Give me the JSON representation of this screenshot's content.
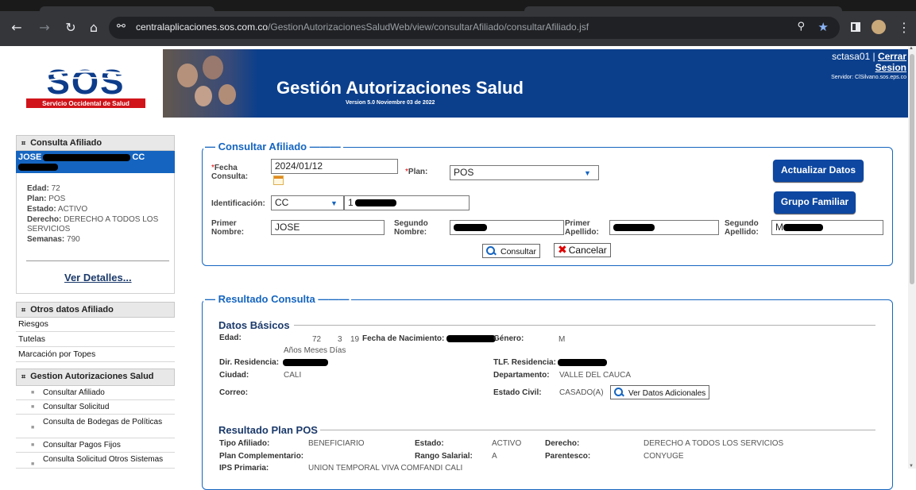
{
  "browser": {
    "url_domain": "centralaplicaciones.sos.com.co",
    "url_path": "/GestionAutorizacionesSaludWeb/view/consultarAfiliado/consultarAfiliado.jsf"
  },
  "header": {
    "logo_text": "SOS",
    "logo_subtitle": "Servicio Occidental de Salud",
    "title": "Gestión Autorizaciones Salud",
    "version": "Version 5.0 Noviembre 03 de 2022",
    "user": "sctasa01 |",
    "logout_line1": "Cerrar",
    "logout_line2": "Sesion",
    "server": "Servidor: ClSilvano.sos.eps.co"
  },
  "sidebar": {
    "consulta_afiliado": {
      "title": "Consulta Afiliado",
      "name": "JOSE",
      "doc_type": "CC",
      "edad_label": "Edad:",
      "edad": "72",
      "plan_label": "Plan:",
      "plan": "POS",
      "estado_label": "Estado:",
      "estado": "ACTIVO",
      "derecho_label": "Derecho:",
      "derecho": "DERECHO A TODOS LOS SERVICIOS",
      "semanas_label": "Semanas:",
      "semanas": "790",
      "ver_detalles": "Ver Detalles..."
    },
    "otros": {
      "title": "Otros datos Afiliado",
      "items": [
        "Riesgos",
        "Tutelas",
        "Marcación por Topes"
      ]
    },
    "gestion": {
      "title": "Gestion Autorizaciones Salud",
      "items": [
        "Consultar Afiliado",
        "Consultar Solicitud",
        "Consulta de Bodegas de Políticas",
        "Consultar Pagos Fijos",
        "Consulta Solicitud Otros Sistemas"
      ]
    }
  },
  "form": {
    "legend": "Consultar Afiliado",
    "fecha_label": "Fecha Consulta:",
    "fecha_value": "2024/01/12",
    "plan_label": "Plan:",
    "plan_value": "POS",
    "ident_label": "Identificación:",
    "ident_type": "CC",
    "ident_number_prefix": "1",
    "primer_nombre_label": "Primer Nombre:",
    "primer_nombre_value": "JOSE",
    "segundo_nombre_label": "Segundo Nombre:",
    "primer_apellido_label": "Primer Apellido:",
    "segundo_apellido_label": "Segundo Apellido:",
    "segundo_apellido_prefix": "M",
    "consultar": "Consultar",
    "cancelar": "Cancelar",
    "actualizar": "Actualizar Datos",
    "grupo": "Grupo Familiar"
  },
  "result": {
    "legend": "Resultado Consulta",
    "basicos_title": "Datos Básicos",
    "edad_label": "Edad:",
    "edad_y": "72",
    "edad_m": "3",
    "edad_d": "19",
    "edad_units": "Años Meses Días",
    "nacimiento_label": "Fecha de Nacimiento:",
    "genero_label": "Género:",
    "genero": "M",
    "dir_label": "Dir. Residencia:",
    "tlf_label": "TLF. Residencia:",
    "ciudad_label": "Ciudad:",
    "ciudad": "CALI",
    "depto_label": "Departamento:",
    "depto": "VALLE DEL CAUCA",
    "correo_label": "Correo:",
    "civil_label": "Estado Civil:",
    "civil": "CASADO(A)",
    "ver_adicionales": "Ver Datos Adicionales",
    "plan_title": "Resultado Plan POS",
    "tipo_label": "Tipo Afiliado:",
    "tipo": "BENEFICIARIO",
    "estado_label": "Estado:",
    "estado": "ACTIVO",
    "derecho_label": "Derecho:",
    "derecho": "DERECHO A TODOS LOS SERVICIOS",
    "complementario_label": "Plan Complementario:",
    "rango_label": "Rango Salarial:",
    "rango": "A",
    "parentesco_label": "Parentesco:",
    "parentesco": "CONYUGE",
    "ips_label": "IPS Primaria:",
    "ips": "UNION TEMPORAL VIVA COMFANDI CALI"
  }
}
